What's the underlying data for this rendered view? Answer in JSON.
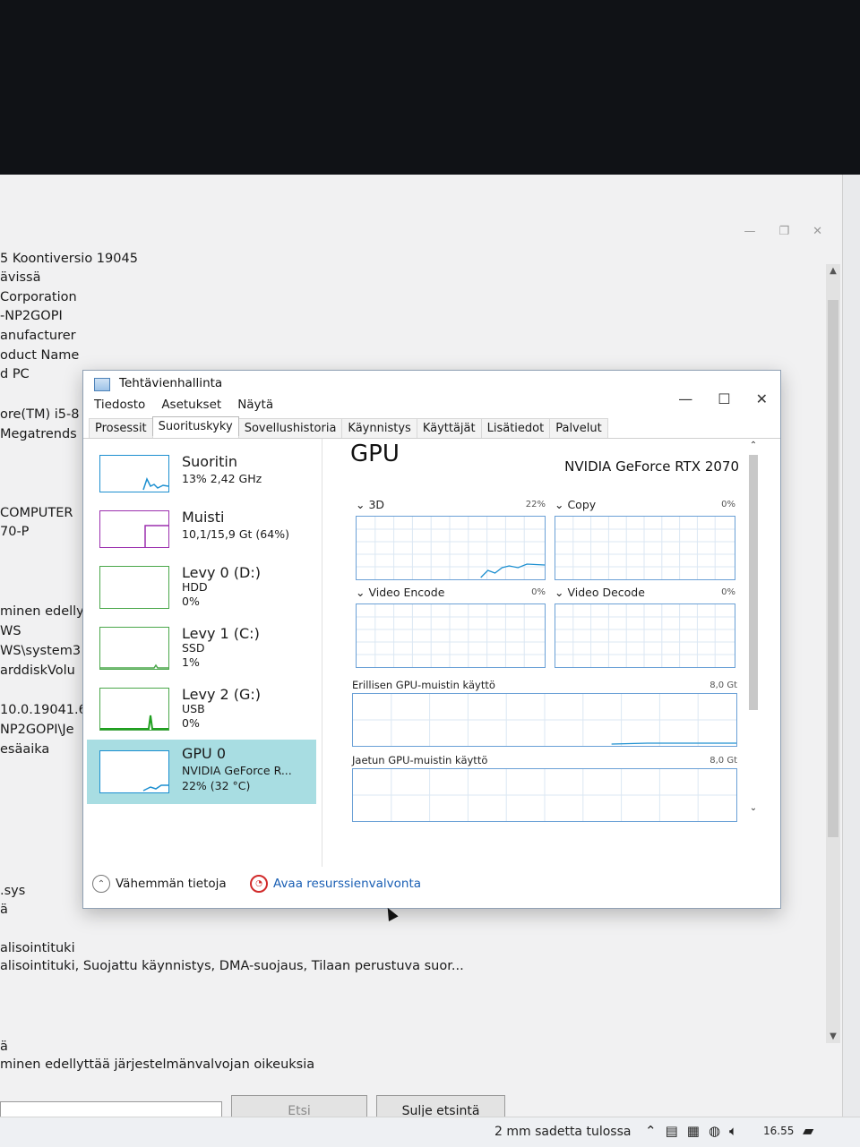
{
  "background_window": {
    "lines_top": [
      "5 Koontiversio 19045",
      "ävissä",
      " Corporation",
      "-NP2GOPI",
      "anufacturer",
      "oduct Name",
      "d PC"
    ],
    "lines_mid": [
      "ore(TM) i5-8",
      " Megatrends"
    ],
    "lines_mid2": [
      "COMPUTER",
      "70-P"
    ],
    "lines_mid3": [
      "minen edelly",
      "WS",
      "WS\\system3",
      "arddiskVolu"
    ],
    "lines_mid4": [
      "10.0.19041.6",
      "NP2GOPI\\Je",
      "esäaika"
    ],
    "lines_low": [
      ".sys",
      "ä"
    ],
    "lines_bottom": [
      "alisointituki",
      "alisointituki, Suojattu käynnistys, DMA-suojaus, Tilaan perustuva suor..."
    ],
    "lines_last": [
      "ä",
      "minen edellyttää järjestelmänvalvojan oikeuksia"
    ],
    "buttons": {
      "search": "Etsi",
      "close_search": "Sulje etsintä"
    }
  },
  "taskbar": {
    "weather": "2 mm sadetta tulossa",
    "clock": "16.55"
  },
  "task_manager": {
    "title": "Tehtävienhallinta",
    "menu": [
      "Tiedosto",
      "Asetukset",
      "Näytä"
    ],
    "tabs": [
      "Prosessit",
      "Suorituskyky",
      "Sovellushistoria",
      "Käynnistys",
      "Käyttäjät",
      "Lisätiedot",
      "Palvelut"
    ],
    "active_tab": "Suorituskyky",
    "sidebar": [
      {
        "name": "Suoritin",
        "sub1": "13% 2,42 GHz",
        "sub2": "",
        "color": "#1c8fd0"
      },
      {
        "name": "Muisti",
        "sub1": "10,1/15,9 Gt (64%)",
        "sub2": "",
        "color": "#9b2fae"
      },
      {
        "name": "Levy 0 (D:)",
        "sub1": "HDD",
        "sub2": "0%",
        "color": "#4aa74a"
      },
      {
        "name": "Levy 1 (C:)",
        "sub1": "SSD",
        "sub2": "1%",
        "color": "#4aa74a"
      },
      {
        "name": "Levy 2 (G:)",
        "sub1": "USB",
        "sub2": "0%",
        "color": "#4aa74a"
      },
      {
        "name": "GPU 0",
        "sub1": "NVIDIA GeForce R...",
        "sub2": "22%  (32 °C)",
        "color": "#1c8fd0"
      }
    ],
    "gpu": {
      "title": "GPU",
      "model": "NVIDIA GeForce RTX 2070",
      "engines": [
        {
          "label": "3D",
          "pct": "22%"
        },
        {
          "label": "Copy",
          "pct": "0%"
        },
        {
          "label": "Video Encode",
          "pct": "0%"
        },
        {
          "label": "Video Decode",
          "pct": "0%"
        }
      ],
      "dedicated_label": "Erillisen GPU-muistin käyttö",
      "dedicated_max": "8,0 Gt",
      "shared_label": "Jaetun GPU-muistin käyttö",
      "shared_max": "8,0 Gt"
    },
    "footer": {
      "fewer_details": "Vähemmän tietoja",
      "open_monitor": "Avaa resurssienvalvonta"
    }
  },
  "colors": {
    "accent_blue": "#1c8fd0",
    "memory_purple": "#9b2fae",
    "disk_green": "#4aa74a",
    "selection": "#a8dde2",
    "link_blue": "#1a5fb4"
  }
}
